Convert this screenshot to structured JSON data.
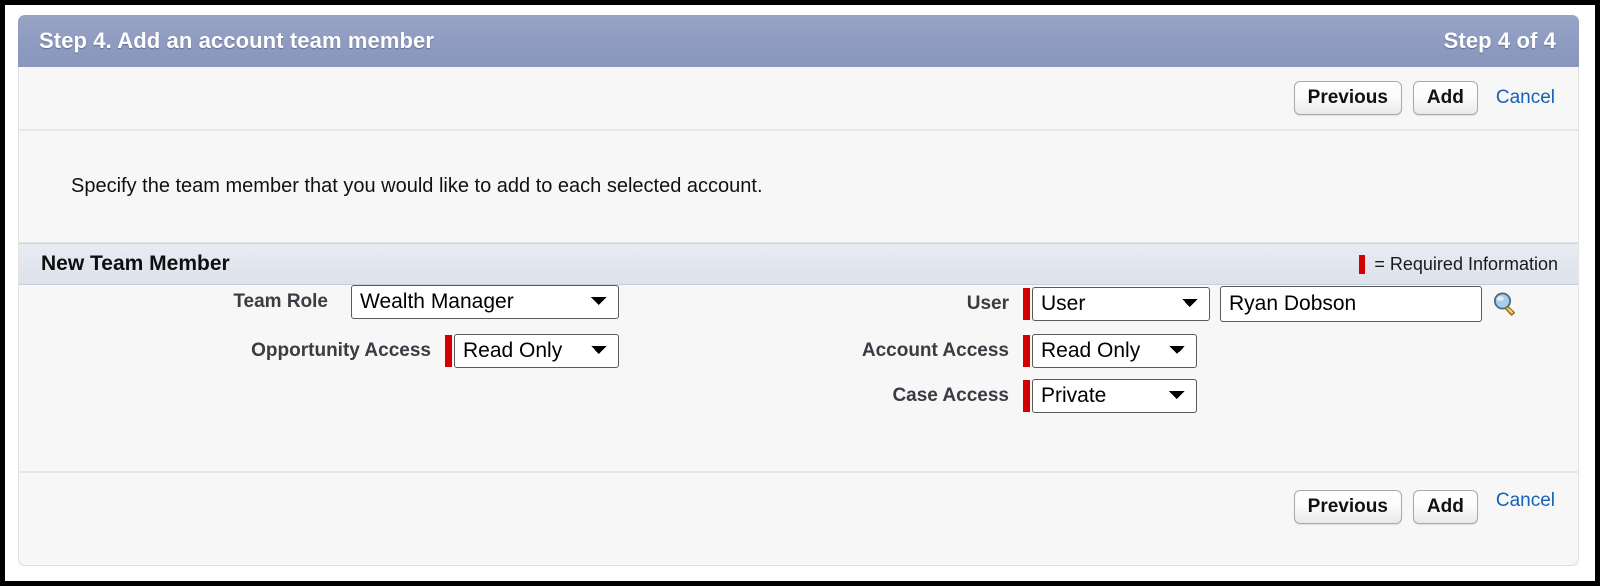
{
  "window": {
    "title": "Step 4. Add an account team member",
    "step_indicator": "Step 4 of 4"
  },
  "toolbar_top": {
    "previous_label": "Previous",
    "add_label": "Add",
    "cancel_label": "Cancel"
  },
  "toolbar_bottom": {
    "previous_label": "Previous",
    "add_label": "Add",
    "cancel_label": "Cancel"
  },
  "instruction": {
    "text": "Specify the team member that you would like to add to each selected account."
  },
  "section": {
    "title": "New Team Member",
    "required_legend": "= Required Information"
  },
  "form": {
    "team_role": {
      "label": "Team Role",
      "value": "Wealth Manager",
      "required": false,
      "options": [
        "Wealth Manager"
      ]
    },
    "opportunity_access": {
      "label": "Opportunity Access",
      "value": "Read Only",
      "required": true,
      "options": [
        "Read Only"
      ]
    },
    "user": {
      "label": "User",
      "type_value": "User",
      "type_options": [
        "User"
      ],
      "name_value": "Ryan Dobson",
      "name_placeholder": "",
      "required": true,
      "lookup_icon": "magnifying-glass-lookup-icon"
    },
    "account_access": {
      "label": "Account Access",
      "value": "Read Only",
      "required": true,
      "options": [
        "Read Only"
      ]
    },
    "case_access": {
      "label": "Case Access",
      "value": "Private",
      "required": true,
      "options": [
        "Private"
      ]
    }
  },
  "colors": {
    "titlebar": "#8e9bc0",
    "required_red": "#d40000",
    "link_blue": "#1661b5",
    "section_header": "#e2e6ee",
    "panel_background": "#f7f7f7"
  }
}
